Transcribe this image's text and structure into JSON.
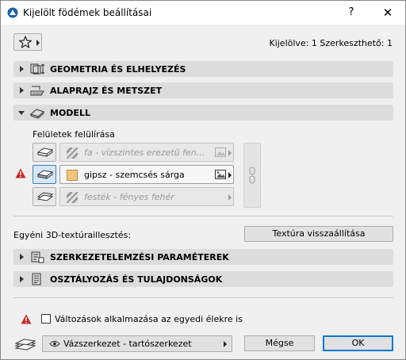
{
  "window": {
    "title": "Kijelölt födémek beállításai",
    "help": "?",
    "close": "✕"
  },
  "selection_info": "Kijelölve: 1 Szerkeszthető: 1",
  "panels": {
    "geometry": "GEOMETRIA ÉS ELHELYEZÉS",
    "plan": "ALAPRAJZ ÉS METSZET",
    "model": "MODELL",
    "structural": "SZERKEZETELEMZÉSI PARAMÉTEREK",
    "classification": "OSZTÁLYOZÁS ÉS TULAJDONSÁGOK"
  },
  "model": {
    "override_label": "Felületek felülírása",
    "surfaces": [
      {
        "name": "fa - vízszintes erezetű fen...",
        "enabled": false,
        "swatch": "hatch"
      },
      {
        "name": "gipsz - szemcsés sárga",
        "enabled": true,
        "swatch": "#f4c57a"
      },
      {
        "name": "festék - fényes fehér",
        "enabled": false,
        "swatch": "hatch"
      }
    ],
    "texture_label": "Egyéni 3D-textúraillesztés:",
    "texture_reset": "Textúra visszaállítása"
  },
  "footer": {
    "apply_label": "Változások alkalmazása az egyedi élekre is",
    "apply_checked": false,
    "layer": "Vázszerkezet - tartószerkezet",
    "cancel": "Mégse",
    "ok": "OK"
  },
  "colors": {
    "accent": "#0078d7",
    "warning": "#c62828",
    "header_bg": "#dcdcdc"
  }
}
